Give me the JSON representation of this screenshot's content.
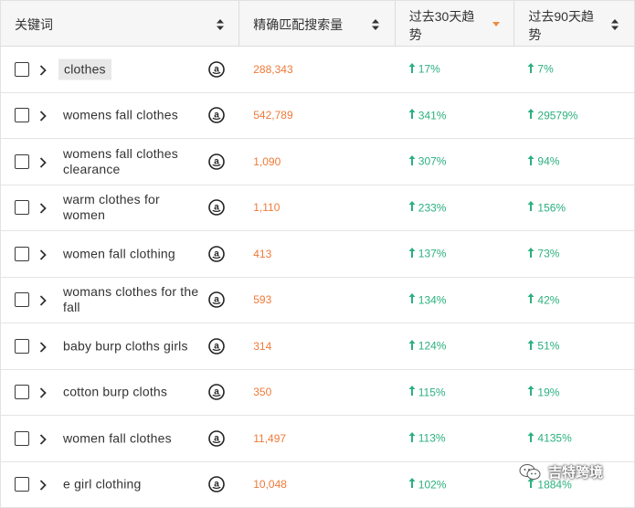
{
  "columns": {
    "keyword": "关键词",
    "exact_volume": "精确匹配搜索量",
    "trend_30": "过去30天趋势",
    "trend_90": "过去90天趋势"
  },
  "colors": {
    "volume": "#ee7a3a",
    "trend_up": "#2bb07f",
    "active_sort": "#f08a3c"
  },
  "icons": {
    "checkbox": "checkbox-icon",
    "expand": "chevron-right-icon",
    "amazon": "amazon-icon",
    "trend": "arrow-up-icon",
    "sort": "sort-icon"
  },
  "rows": [
    {
      "keyword": "clothes",
      "volume": "288,343",
      "trend30": "17%",
      "trend90": "7%"
    },
    {
      "keyword": "womens fall clothes",
      "volume": "542,789",
      "trend30": "341%",
      "trend90": "29579%"
    },
    {
      "keyword": "womens fall clothes clearance",
      "volume": "1,090",
      "trend30": "307%",
      "trend90": "94%"
    },
    {
      "keyword": "warm clothes for women",
      "volume": "1,110",
      "trend30": "233%",
      "trend90": "156%"
    },
    {
      "keyword": "women fall clothing",
      "volume": "413",
      "trend30": "137%",
      "trend90": "73%"
    },
    {
      "keyword": "womans clothes for the fall",
      "volume": "593",
      "trend30": "134%",
      "trend90": "42%"
    },
    {
      "keyword": "baby burp cloths girls",
      "volume": "314",
      "trend30": "124%",
      "trend90": "51%"
    },
    {
      "keyword": "cotton burp cloths",
      "volume": "350",
      "trend30": "115%",
      "trend90": "19%"
    },
    {
      "keyword": "women fall clothes",
      "volume": "11,497",
      "trend30": "113%",
      "trend90": "4135%"
    },
    {
      "keyword": "e girl clothing",
      "volume": "10,048",
      "trend30": "102%",
      "trend90": "1884%"
    }
  ],
  "watermark": "吉特跨境"
}
